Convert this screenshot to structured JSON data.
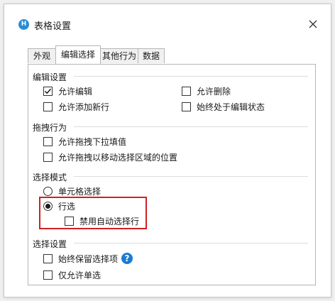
{
  "window": {
    "title": "表格设置",
    "app_icon_letter": "H",
    "close_label": "Close"
  },
  "tabs": [
    {
      "label": "外观",
      "active": false
    },
    {
      "label": "编辑选择",
      "active": true
    },
    {
      "label": "其他行为",
      "active": false
    },
    {
      "label": "数据",
      "active": false
    }
  ],
  "sections": {
    "edit": {
      "title": "编辑设置",
      "allow_edit": {
        "label": "允许编辑",
        "checked": true
      },
      "allow_delete": {
        "label": "允许删除",
        "checked": false
      },
      "allow_add": {
        "label": "允许添加新行",
        "checked": false
      },
      "always_edit": {
        "label": "始终处于编辑状态",
        "checked": false
      }
    },
    "drag": {
      "title": "拖拽行为",
      "drag_fill": {
        "label": "允许拖拽下拉填值",
        "checked": false
      },
      "drag_move": {
        "label": "允许拖拽以移动选择区域的位置",
        "checked": false
      }
    },
    "select_mode": {
      "title": "选择模式",
      "cell": {
        "label": "单元格选择",
        "selected": false
      },
      "row": {
        "label": "行选",
        "selected": true
      },
      "disable_auto": {
        "label": "禁用自动选择行",
        "checked": false
      }
    },
    "select_settings": {
      "title": "选择设置",
      "keep": {
        "label": "始终保留选择项",
        "checked": false
      },
      "single": {
        "label": "仅允许单选",
        "checked": false
      },
      "help_icon": "?"
    }
  },
  "colors": {
    "highlight": "#d02020",
    "help": "#1b7bd3",
    "app_icon": "#2a8bd5"
  }
}
